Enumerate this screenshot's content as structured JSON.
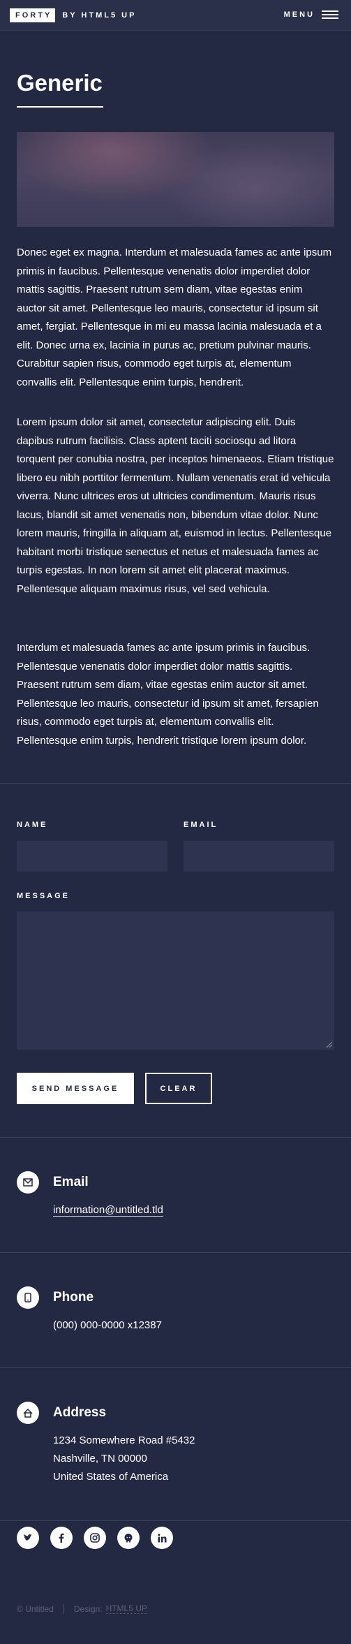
{
  "header": {
    "logo_text": "FORTY",
    "logo_suffix": "BY HTML5 UP",
    "menu_label": "MENU"
  },
  "main": {
    "title": "Generic",
    "paragraphs": [
      "Donec eget ex magna. Interdum et malesuada fames ac ante ipsum primis in faucibus. Pellentesque venenatis dolor imperdiet dolor mattis sagittis. Praesent rutrum sem diam, vitae egestas enim auctor sit amet. Pellentesque leo mauris, consectetur id ipsum sit amet, fergiat. Pellentesque in mi eu massa lacinia malesuada et a elit. Donec urna ex, lacinia in purus ac, pretium pulvinar mauris. Curabitur sapien risus, commodo eget turpis at, elementum convallis elit. Pellentesque enim turpis, hendrerit.",
      "Lorem ipsum dolor sit amet, consectetur adipiscing elit. Duis dapibus rutrum facilisis. Class aptent taciti sociosqu ad litora torquent per conubia nostra, per inceptos himenaeos. Etiam tristique libero eu nibh porttitor fermentum. Nullam venenatis erat id vehicula viverra. Nunc ultrices eros ut ultricies condimentum. Mauris risus lacus, blandit sit amet venenatis non, bibendum vitae dolor. Nunc lorem mauris, fringilla in aliquam at, euismod in lectus. Pellentesque habitant morbi tristique senectus et netus et malesuada fames ac turpis egestas. In non lorem sit amet elit placerat maximus. Pellentesque aliquam maximus risus, vel sed vehicula.",
      "Interdum et malesuada fames ac ante ipsum primis in faucibus. Pellentesque venenatis dolor imperdiet dolor mattis sagittis. Praesent rutrum sem diam, vitae egestas enim auctor sit amet. Pellentesque leo mauris, consectetur id ipsum sit amet, fersapien risus, commodo eget turpis at, elementum convallis elit. Pellentesque enim turpis, hendrerit tristique lorem ipsum dolor."
    ]
  },
  "form": {
    "name_label": "NAME",
    "name_value": "",
    "email_label": "EMAIL",
    "email_value": "",
    "message_label": "MESSAGE",
    "message_value": "",
    "send_label": "SEND MESSAGE",
    "clear_label": "CLEAR"
  },
  "contact": {
    "email_heading": "Email",
    "email_value": "information@untitled.tld",
    "phone_heading": "Phone",
    "phone_value": "(000) 000-0000 x12387",
    "address_heading": "Address",
    "address_lines": [
      "1234 Somewhere Road #5432",
      "Nashville, TN 00000",
      "United States of America"
    ]
  },
  "social_icons": [
    "twitter-icon",
    "facebook-icon",
    "instagram-icon",
    "github-icon",
    "linkedin-icon"
  ],
  "footer": {
    "copyright": "© Untitled",
    "design_prefix": "Design:",
    "design_link": "HTML5 UP"
  },
  "colors": {
    "background": "#242943",
    "header_background": "#2a2f4a",
    "field_background": "#2e3350",
    "text": "#ffffff"
  }
}
